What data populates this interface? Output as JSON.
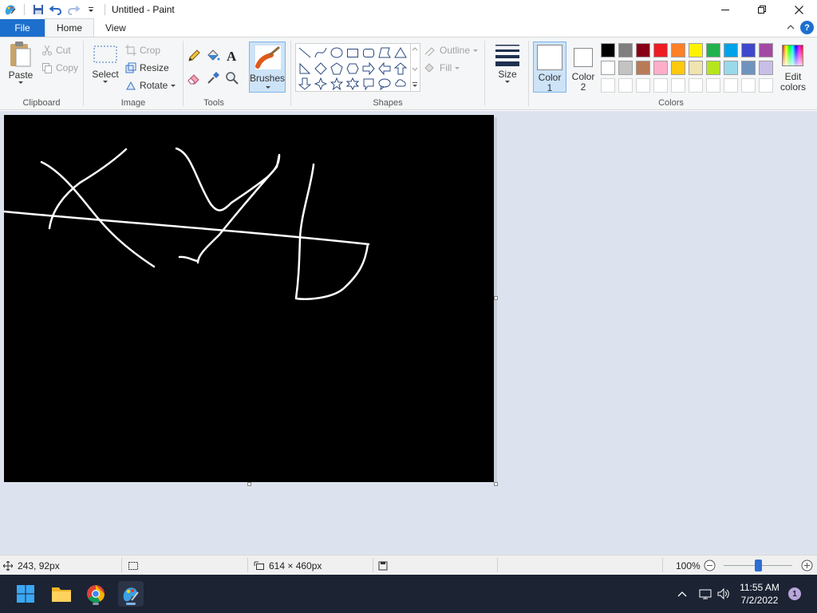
{
  "window": {
    "title": "Untitled - Paint"
  },
  "tabs": {
    "file": "File",
    "home": "Home",
    "view": "View"
  },
  "help_label": "?",
  "clipboard": {
    "paste": "Paste",
    "cut": "Cut",
    "copy": "Copy",
    "group_label": "Clipboard"
  },
  "image": {
    "select": "Select",
    "crop": "Crop",
    "resize": "Resize",
    "rotate": "Rotate",
    "group_label": "Image"
  },
  "tools": {
    "group_label": "Tools",
    "brushes": "Brushes"
  },
  "shapes": {
    "outline": "Outline",
    "fill": "Fill",
    "group_label": "Shapes",
    "size": "Size"
  },
  "colors": {
    "color1_line1": "Color",
    "color1_line2": "1",
    "color2_line1": "Color",
    "color2_line2": "2",
    "edit_line1": "Edit",
    "edit_line2": "colors",
    "group_label": "Colors",
    "color1_value": "#ffffff",
    "color2_value": "#ffffff",
    "palette_row1": [
      "#000000",
      "#7f7f7f",
      "#880015",
      "#ed1c24",
      "#ff7f27",
      "#fff200",
      "#22b14c",
      "#00a2e8",
      "#3f48cc",
      "#a349a4"
    ],
    "palette_row2": [
      "#ffffff",
      "#c3c3c3",
      "#b97a57",
      "#ffaec9",
      "#ffc90e",
      "#efe4b0",
      "#b5e61d",
      "#99d9ea",
      "#7092be",
      "#c8bfe7"
    ]
  },
  "status": {
    "cursor_pos": "243, 92px",
    "canvas_size": "614 × 460px",
    "zoom": "100%",
    "zoom_fraction": 0.5
  },
  "taskbar": {
    "time": "11:55 AM",
    "date": "7/2/2022",
    "notifications": "1"
  }
}
